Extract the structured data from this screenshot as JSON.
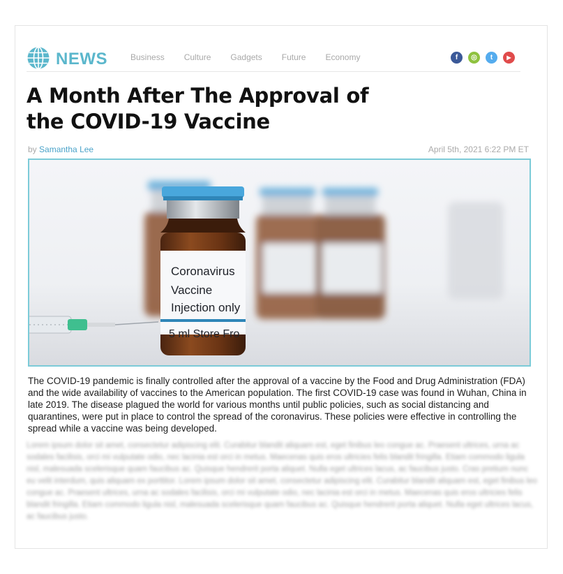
{
  "site": {
    "logo_text": "NEWS",
    "nav": [
      "Business",
      "Culture",
      "Gadgets",
      "Future",
      "Economy"
    ],
    "social": [
      {
        "name": "facebook",
        "glyph": "f",
        "color": "#3b5998"
      },
      {
        "name": "instagram",
        "glyph": "◎",
        "color": "#8fc23f"
      },
      {
        "name": "twitter",
        "glyph": "t",
        "color": "#55acee"
      },
      {
        "name": "youtube",
        "glyph": "▶",
        "color": "#e04b4b"
      }
    ]
  },
  "article": {
    "title_line1": "A Month After The Approval of",
    "title_line2": "the COVID-19 Vaccine",
    "by_prefix": "by",
    "author": "Samantha Lee",
    "date": "April 5th, 2021 6:22 PM ET",
    "image_label": {
      "line1": "Coronavirus",
      "line2": "Vaccine",
      "line3": "Injection only",
      "line4": "5 ml  Store Fro"
    },
    "body": "The COVID-19 pandemic is finally controlled after the approval of a vaccine by the Food and Drug Administration (FDA) and the wide availability of vaccines to the American population. The first COVID-19 case was found in Wuhan, China in late 2019. The disease plagued the world for various months until public policies, such as social distancing and quarantines, were put in place to control the spread of the coronavirus. These policies were effective in controlling the spread while a vaccine was being developed.",
    "blurred": "Lorem ipsum dolor sit amet, consectetur adipiscing elit. Curabitur blandit aliquam est, eget finibus leo congue ac. Praesent ultrices, urna ac sodales facilisis, orci mi vulputate odio, nec lacinia est orci in metus. Maecenas quis eros ultricies felis blandit fringilla. Etiam commodo ligula nisl, malesuada scelerisque quam faucibus ac. Quisque hendrerit porta aliquet. Nulla eget ultrices lacus, ac faucibus justo. Cras pretium nunc eu velit interdum, quis aliquam ex porttitor. Lorem ipsum dolor sit amet, consectetur adipiscing elit. Curabitur blandit aliquam est, eget finibus leo congue ac. Praesent ultrices, urna ac sodales facilisis, orci mi vulputate odio, nec lacinia est orci in metus. Maecenas quis eros ultricies felis blandit fringilla. Etiam commodo ligula nisl, malesuada scelerisque quam faucibus ac. Quisque hendrerit porta aliquet. Nulla eget ultrices lacus, ac faucibus justo."
  },
  "colors": {
    "brand": "#5bb7cc",
    "author_link": "#4aa3c9",
    "photo_border": "#7ccbd8"
  }
}
